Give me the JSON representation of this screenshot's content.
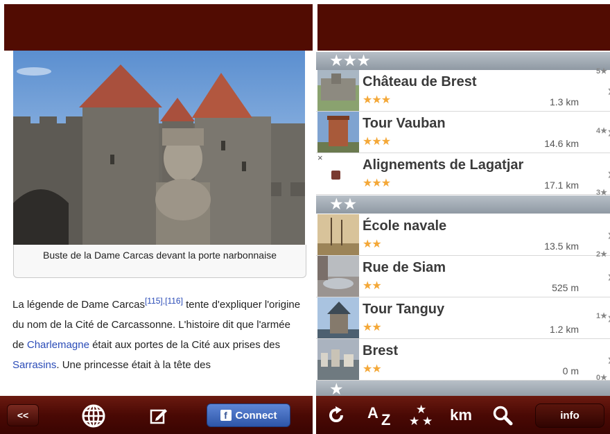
{
  "left": {
    "photo_caption": "Buste de la Dame Carcas devant la porte narbonnaise",
    "article": {
      "p1": "La légende de Dame Carcas",
      "ref1": "[115]",
      "refsep": ",",
      "ref2": "[116]",
      "p2": " tente d'expliquer l'origine du nom de la Cité de Carcassonne. L'histoire dit que l'armée de ",
      "link1": "Charlemagne",
      "p3": " était aux portes de la Cité aux prises des ",
      "link2": "Sarrasins",
      "p4": ". Une princesse était à la tête des"
    },
    "toolbar": {
      "back_label": "<<",
      "connect_label": "Connect",
      "fb_letter": "f"
    }
  },
  "right": {
    "sections": [
      {
        "stars": "★★★"
      },
      {
        "stars": "★★"
      },
      {
        "stars": "★"
      }
    ],
    "items": [
      {
        "name": "Château de Brest",
        "stars": "★★★",
        "distance": "1.3 km"
      },
      {
        "name": "Tour Vauban",
        "stars": "★★★",
        "distance": "14.6 km"
      },
      {
        "name": "Alignements de Lagatjar",
        "stars": "★★★",
        "distance": "17.1 km"
      },
      {
        "name": "École navale",
        "stars": "★★",
        "distance": "13.5 km"
      },
      {
        "name": "Rue de Siam",
        "stars": "★★",
        "distance": "525 m"
      },
      {
        "name": "Tour Tanguy",
        "stars": "★★",
        "distance": "1.2 km"
      },
      {
        "name": "Brest",
        "stars": "★★",
        "distance": "0 m"
      }
    ],
    "index": [
      "5★",
      "4★",
      "3★",
      "2★",
      "1★",
      "0★"
    ],
    "toolbar": {
      "sort_alpha": "A",
      "sort_alpha_sub": "Z",
      "sort_km": "km",
      "info_label": "info"
    }
  },
  "colors": {
    "topbar": "#510c02",
    "star": "#f4a838",
    "link": "#2a4bb7",
    "facebook": "#3b5998"
  },
  "icons": [
    "back-icon",
    "globe-icon",
    "edit-icon",
    "facebook-icon",
    "refresh-icon",
    "sort-alpha-icon",
    "sort-stars-icon",
    "search-icon",
    "chevron-right-icon"
  ]
}
